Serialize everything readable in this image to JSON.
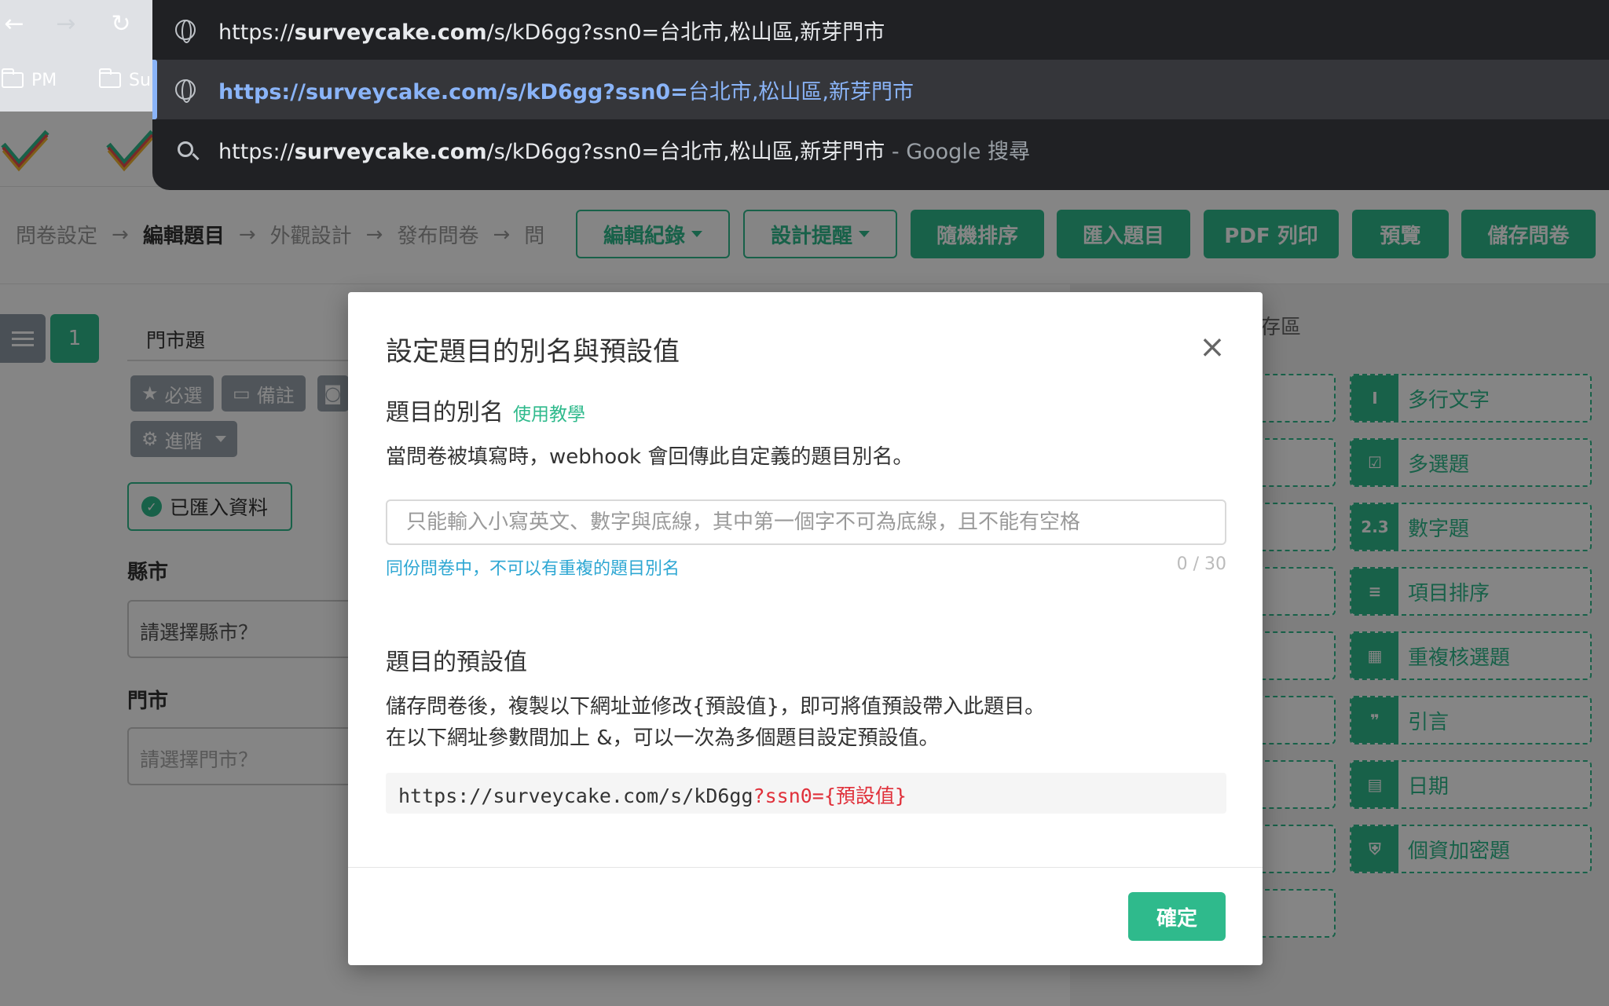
{
  "browser": {
    "back_icon": "arrow-left-icon",
    "forward_icon": "arrow-right-icon",
    "reload_icon": "reload-icon",
    "bookmarks": [
      {
        "label": "PM"
      },
      {
        "label": "Su"
      }
    ]
  },
  "omnibox": {
    "suggestion_1": {
      "prefix": "https://",
      "domain": "surveycake.com",
      "rest": "/s/kD6gg?ssn0=台北市,松山區,新芽門市"
    },
    "suggestion_2": {
      "bold": "https://surveycake.com/s/kD6gg?ssn0=",
      "rest": "台北市,松山區,新芽門市"
    },
    "suggestion_3": {
      "prefix": "https://",
      "domain": "surveycake.com",
      "rest": "/s/kD6gg?ssn0=台北市,松山區,新芽門市",
      "suffix": " - Google 搜尋"
    }
  },
  "toolbar": {
    "crumbs": [
      "問卷設定",
      "編輯題目",
      "外觀設計",
      "發布問卷",
      "問"
    ],
    "arrow": "→",
    "edit_log": "編輯紀錄",
    "design_tips": "設計提醒",
    "random_order": "隨機排序",
    "import": "匯入題目",
    "pdf": "PDF 列印",
    "preview": "預覽",
    "save": "儲存問卷"
  },
  "question": {
    "number": "1",
    "title": "門市題",
    "required": "必選",
    "note": "備註",
    "advanced": "進階",
    "imported": "已匯入資料",
    "city_label": "縣市",
    "city_placeholder": "請選擇縣市？",
    "store_label": "門市",
    "store_placeholder": "請選擇門市？"
  },
  "right_panel": {
    "title_fragment": "存區",
    "items": [
      {
        "label": "多行文字",
        "icon": "I"
      },
      {
        "label": "多選題",
        "icon": "☑"
      },
      {
        "label": "數字題",
        "icon": "2.3"
      },
      {
        "label": "項目排序",
        "icon": "≡"
      },
      {
        "label": "重複核選題",
        "icon": "▦"
      },
      {
        "label": "引言",
        "icon": "❞"
      },
      {
        "label": "日期",
        "icon": "▤"
      },
      {
        "label": "個資加密題",
        "icon": "⛨"
      }
    ]
  },
  "modal": {
    "title": "設定題目的別名與預設值",
    "alias_heading": "題目的別名",
    "alias_link": "使用教學",
    "alias_desc": "當問卷被填寫時，webhook 會回傳此自定義的題目別名。",
    "alias_placeholder": "只能輸入小寫英文、數字與底線，其中第一個字不可為底線，且不能有空格",
    "alias_value": "",
    "alias_hint": "同份問卷中，不可以有重複的題目別名",
    "alias_count": "0 / 30",
    "default_heading": "題目的預設值",
    "default_desc_1": "儲存問卷後，複製以下網址並修改{預設值}，即可將值預設帶入此題目。",
    "default_desc_2": "在以下網址參數間加上 &，可以一次為多個題目設定預設值。",
    "code_base": "https://surveycake.com/s/kD6gg",
    "code_param": "?ssn0={預設值}",
    "ok": "確定"
  },
  "colors": {
    "brand_green": "#2fba8c",
    "omnibox_bg": "#202124",
    "link_blue": "#8ab4f8",
    "param_red": "#e0303a"
  }
}
